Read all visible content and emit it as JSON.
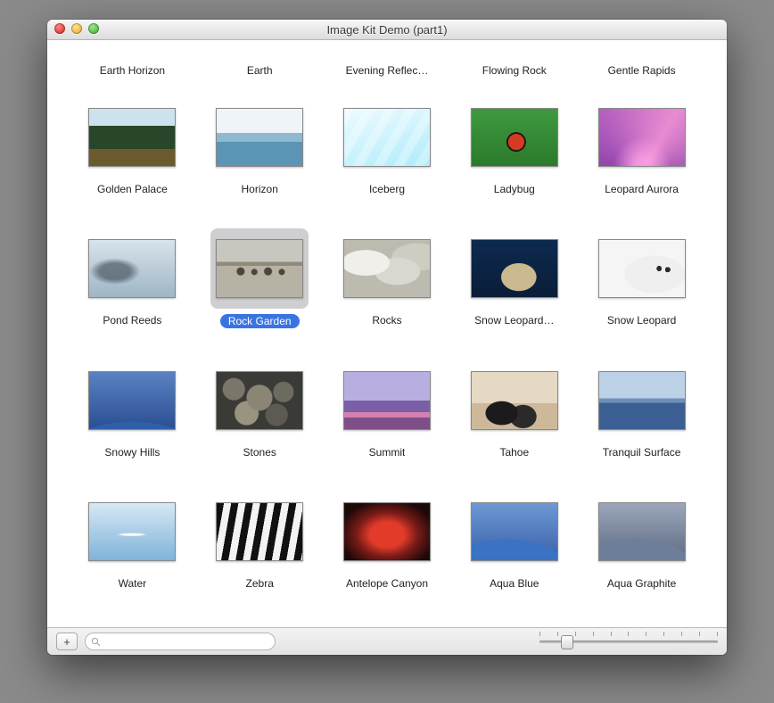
{
  "window": {
    "title": "Image Kit Demo (part1)"
  },
  "selectedIndex": 11,
  "row0": [
    {
      "label": "Earth Horizon"
    },
    {
      "label": "Earth"
    },
    {
      "label": "Evening Reflec…"
    },
    {
      "label": "Flowing Rock"
    },
    {
      "label": "Gentle Rapids"
    }
  ],
  "items": [
    {
      "label": "Golden Palace",
      "thumb": "t-golden"
    },
    {
      "label": "Horizon",
      "thumb": "t-horizon"
    },
    {
      "label": "Iceberg",
      "thumb": "t-iceberg"
    },
    {
      "label": "Ladybug",
      "thumb": "t-ladybug"
    },
    {
      "label": "Leopard Aurora",
      "thumb": "t-leopard-aurora"
    },
    {
      "label": "Pond Reeds",
      "thumb": "t-pond"
    },
    {
      "label": "Rock Garden",
      "thumb": "t-rockgarden"
    },
    {
      "label": "Rocks",
      "thumb": "t-rocks"
    },
    {
      "label": "Snow Leopard…",
      "thumb": "t-snowprowl"
    },
    {
      "label": "Snow Leopard",
      "thumb": "t-snowleopard"
    },
    {
      "label": "Snowy Hills",
      "thumb": "t-snowyhills"
    },
    {
      "label": "Stones",
      "thumb": "t-stones"
    },
    {
      "label": "Summit",
      "thumb": "t-summit"
    },
    {
      "label": "Tahoe",
      "thumb": "t-tahoe"
    },
    {
      "label": "Tranquil Surface",
      "thumb": "t-tranquil"
    },
    {
      "label": "Water",
      "thumb": "t-water"
    },
    {
      "label": "Zebra",
      "thumb": "t-zebra"
    },
    {
      "label": "Antelope Canyon",
      "thumb": "t-antelope"
    },
    {
      "label": "Aqua Blue",
      "thumb": "t-aquablue"
    },
    {
      "label": "Aqua Graphite",
      "thumb": "t-aquagraphite"
    }
  ],
  "toolbar": {
    "add_label": "+",
    "search_value": "",
    "search_placeholder": "",
    "slider_value": 15,
    "slider_ticks": 11
  }
}
